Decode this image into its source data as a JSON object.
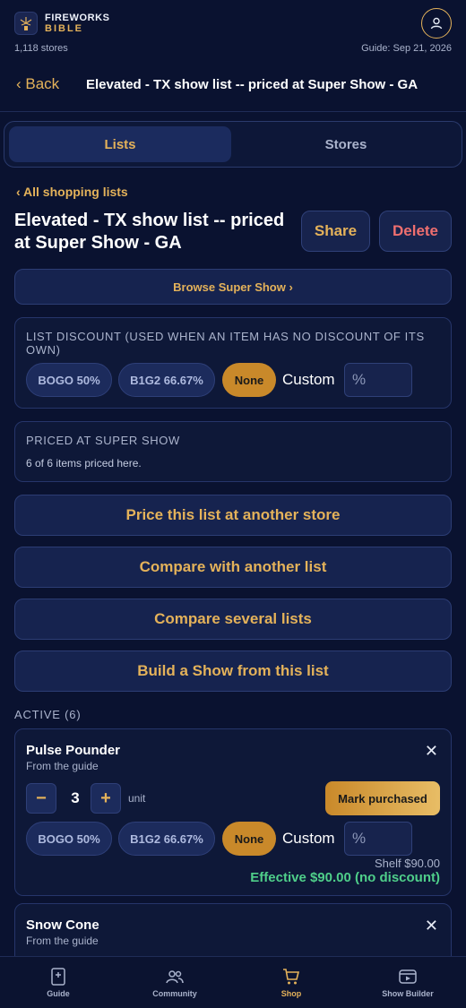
{
  "header": {
    "logo_line1": "FIREWORKS",
    "logo_line2": "BIBLE",
    "stores_count": "1,118 stores",
    "guide_date": "Guide: Sep 21, 2026"
  },
  "nav": {
    "back_label": "‹ Back",
    "title": "Elevated - TX show list -- priced at Super Show - GA"
  },
  "tabs": [
    {
      "label": "Lists",
      "active": true
    },
    {
      "label": "Stores",
      "active": false
    }
  ],
  "list": {
    "all_lists_link": "‹ All shopping lists",
    "title": "Elevated - TX show list -- priced at Super Show - GA",
    "share_label": "Share",
    "delete_label": "Delete",
    "browse_label": "Browse Super Show ›"
  },
  "discount": {
    "label": "LIST DISCOUNT (USED WHEN AN ITEM HAS NO DISCOUNT OF ITS OWN)",
    "options": [
      "BOGO 50%",
      "B1G2 66.67%",
      "None"
    ],
    "selected": "None",
    "custom_label": "Custom",
    "custom_placeholder": "%"
  },
  "priced": {
    "label": "PRICED AT SUPER SHOW",
    "summary": "6 of 6 items priced here."
  },
  "actions": [
    "Price this list at another store",
    "Compare with another list",
    "Compare several lists",
    "Build a Show from this list"
  ],
  "active_section": {
    "label": "ACTIVE (6)",
    "items": [
      {
        "name": "Pulse Pounder",
        "source": "From the guide",
        "quantity": "3",
        "unit": "unit",
        "mark_label": "Mark purchased",
        "discount_options": [
          "BOGO 50%",
          "B1G2 66.67%",
          "None"
        ],
        "selected_discount": "None",
        "custom_label": "Custom",
        "custom_placeholder": "%",
        "shelf": "Shelf $90.00",
        "effective": "Effective $90.00 (no discount)"
      },
      {
        "name": "Snow Cone",
        "source": "From the guide"
      }
    ]
  },
  "bottom_nav": [
    {
      "label": "Guide",
      "icon": "guide-book-icon",
      "active": false
    },
    {
      "label": "Community",
      "icon": "people-icon",
      "active": false
    },
    {
      "label": "Shop",
      "icon": "cart-icon",
      "active": true
    },
    {
      "label": "Show Builder",
      "icon": "video-icon",
      "active": false
    }
  ],
  "colors": {
    "background": "#0a1230",
    "accent_gold": "#e4b25a",
    "delete_red": "#ef6f6f",
    "effective_green": "#4fcf8a"
  }
}
